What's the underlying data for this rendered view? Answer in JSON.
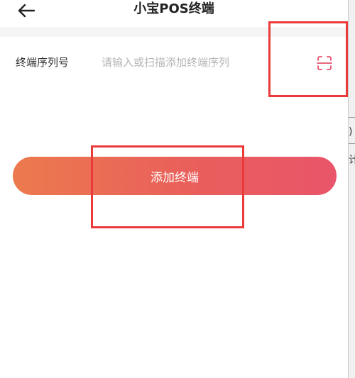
{
  "header": {
    "title": "小宝POS终端",
    "back_icon": "arrow-left-icon"
  },
  "form": {
    "serial_label": "终端序列号",
    "serial_value": "",
    "serial_placeholder": "请输入或扫描添加终端序列",
    "scan_icon": "scan-icon"
  },
  "actions": {
    "add_terminal_label": "添加终端"
  },
  "edge": {
    "char_1": ")",
    "char_2": "计"
  },
  "colors": {
    "accent_start": "#ec7a4e",
    "accent_end": "#e9556a",
    "scan_icon": "#e5506b",
    "annotation": "#ea3a3a"
  }
}
